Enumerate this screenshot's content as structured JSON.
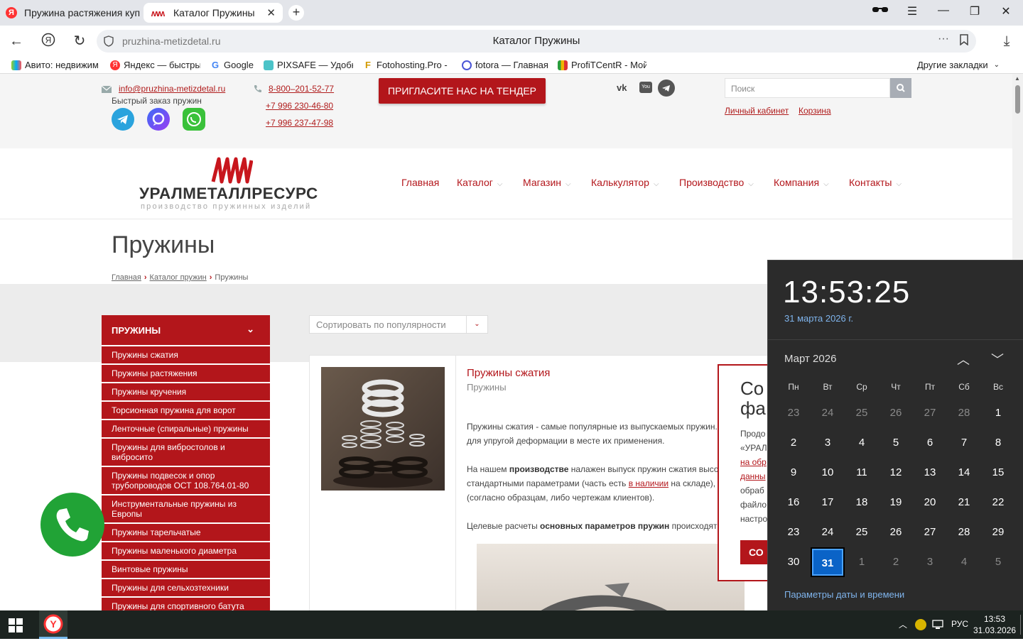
{
  "browser": {
    "tabs": [
      {
        "title": "Пружина растяжения куп",
        "active": false
      },
      {
        "title": "Каталог Пружины",
        "active": true
      }
    ],
    "url": "pruzhina-metizdetal.ru",
    "page_title": "Каталог Пружины",
    "bookmarks": [
      "Авито: недвижим",
      "Яндекс — быстры",
      "Google",
      "PIXSAFE — Удобн",
      "Fotohosting.Pro - ",
      "fotora — Главная",
      "ProfiTCentR - Мой"
    ],
    "other_bookmarks": "Другие закладки"
  },
  "site": {
    "email": "info@pruzhina-metizdetal.ru",
    "fast_order": "Быстрый заказ пружин",
    "phones": [
      "8-800–201-52-77",
      "+7 996 230-46-80",
      "+7 996 237-47-98"
    ],
    "tender_button": "ПРИГЛАСИТЕ НАС НА ТЕНДЕР",
    "search_placeholder": "Поиск",
    "cabinet": "Личный кабинет",
    "cart": "Корзина",
    "logo_text": "УРАЛМЕТАЛЛРЕСУРС",
    "logo_sub": "производство пружинных изделий",
    "menu": [
      "Главная",
      "Каталог",
      "Магазин",
      "Калькулятор",
      "Производство",
      "Компания",
      "Контакты"
    ],
    "heading": "Пружины",
    "breadcrumbs": [
      "Главная",
      "Каталог пружин",
      "Пружины"
    ],
    "sort_label": "Сортировать по популярности",
    "sidebar_title": "ПРУЖИНЫ",
    "sidebar_items": [
      "Пружины сжатия",
      "Пружины растяжения",
      "Пружины кручения",
      "Торсионная пружина для ворот",
      "Ленточные (спиральные) пружины",
      "Пружины для вибростолов и вибросито",
      "Пружины подвесок и опор трубопроводов ОСТ 108.764.01-80",
      "Инструментальные пружины из Европы",
      "Пружины тарельчатые",
      "Пружины маленького диаметра",
      "Винтовые пружины",
      "Пружины для сельхозтехники",
      "Пружины для спортивного батута"
    ],
    "product": {
      "title": "Пружины сжатия",
      "category": "Пружины",
      "p1a": "Пружины сжатия - самые популярные из выпускаемых пружин.",
      "p1b": "для упругой деформации в месте их применения.",
      "p2a_pre": "На нашем ",
      "p2a_bold": "производстве",
      "p2a_post": " налажен выпуск пружин сжатия высо",
      "p2b_pre": "стандартными параметрами (часть есть ",
      "p2b_link": "в наличии",
      "p2b_post": " на складе),",
      "p2c": "(согласно образцам, либо чертежам клиентов).",
      "p3_pre": "Целевые расчеты ",
      "p3_bold": "основных параметров пружин",
      "p3_post": " происходят"
    },
    "cookie": {
      "title1": "Со",
      "title2": "фа",
      "lines": [
        "Продо",
        "«УРАЛ",
        "на обр",
        "данны",
        "обраб",
        "файло",
        "настро"
      ],
      "button": "СО"
    }
  },
  "clock": {
    "time": "13:53:25",
    "date": "31 марта 2026 г.",
    "month": "Март 2026",
    "weekdays": [
      "Пн",
      "Вт",
      "Ср",
      "Чт",
      "Пт",
      "Сб",
      "Вс"
    ],
    "days": [
      [
        "23",
        "24",
        "25",
        "26",
        "27",
        "28",
        "1"
      ],
      [
        "2",
        "3",
        "4",
        "5",
        "6",
        "7",
        "8"
      ],
      [
        "9",
        "10",
        "11",
        "12",
        "13",
        "14",
        "15"
      ],
      [
        "16",
        "17",
        "18",
        "19",
        "20",
        "21",
        "22"
      ],
      [
        "23",
        "24",
        "25",
        "26",
        "27",
        "28",
        "29"
      ],
      [
        "30",
        "31",
        "1",
        "2",
        "3",
        "4",
        "5"
      ]
    ],
    "today": "31",
    "settings": "Параметры даты и времени"
  },
  "taskbar": {
    "lang": "РУС",
    "time": "13:53",
    "date": "31.03.2026"
  },
  "colors": {
    "brand_red": "#b3161b",
    "today_blue": "#0a63c7",
    "phone_green": "#21a336"
  }
}
